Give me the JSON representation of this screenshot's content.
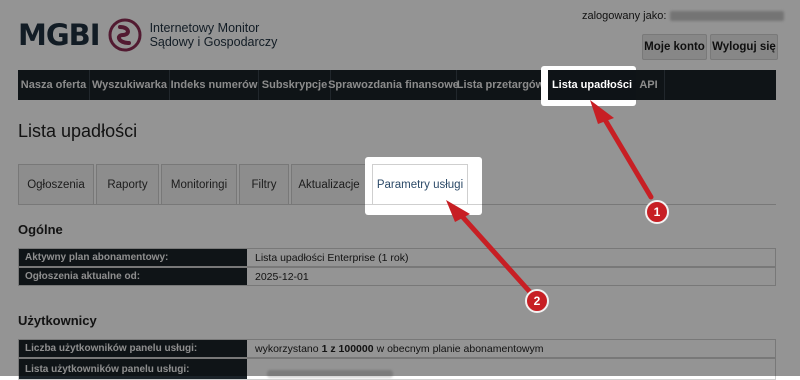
{
  "brand": {
    "logo_text": "MGBI",
    "subtitle_line1": "Internetowy Monitor",
    "subtitle_line2": "Sądowy i Gospodarczy"
  },
  "user": {
    "logged_in_label": "zalogowany jako:",
    "account_button": "Moje konto",
    "logout_button": "Wyloguj się"
  },
  "nav": {
    "items": [
      {
        "label": "Nasza oferta"
      },
      {
        "label": "Wyszukiwarka"
      },
      {
        "label": "Indeks numerów"
      },
      {
        "label": "Subskrypcje"
      },
      {
        "label": "Sprawozdania finansowe"
      },
      {
        "label": "Lista przetargów"
      },
      {
        "label": "Lista upadłości"
      },
      {
        "label": "API"
      }
    ],
    "active_index": 6
  },
  "page_title": "Lista upadłości",
  "tabs": {
    "items": [
      {
        "label": "Ogłoszenia"
      },
      {
        "label": "Raporty"
      },
      {
        "label": "Monitoringi"
      },
      {
        "label": "Filtry"
      },
      {
        "label": "Aktualizacje"
      },
      {
        "label": "Parametry usługi"
      }
    ],
    "active_index": 5
  },
  "general": {
    "title": "Ogólne",
    "rows": [
      {
        "key": "Aktywny plan abonamentowy:",
        "value": "Lista upadłości Enterprise (1 rok)"
      },
      {
        "key": "Ogłoszenia aktualne od:",
        "value": "2025-12-01"
      }
    ]
  },
  "users": {
    "title": "Użytkownicy",
    "count_key": "Liczba użytkowników panelu usługi:",
    "count_prefix": "wykorzystano",
    "count_value": "1 z 100000",
    "count_suffix": "w obecnym planie abonamentowym",
    "list_key": "Lista użytkowników panelu usługi:"
  },
  "annotations": {
    "badge_1": "1",
    "badge_2": "2",
    "color": "#c71f24"
  },
  "colors": {
    "nav_bg": "#1b2329",
    "brand": "#1f3140",
    "accent": "#8e2d55"
  }
}
